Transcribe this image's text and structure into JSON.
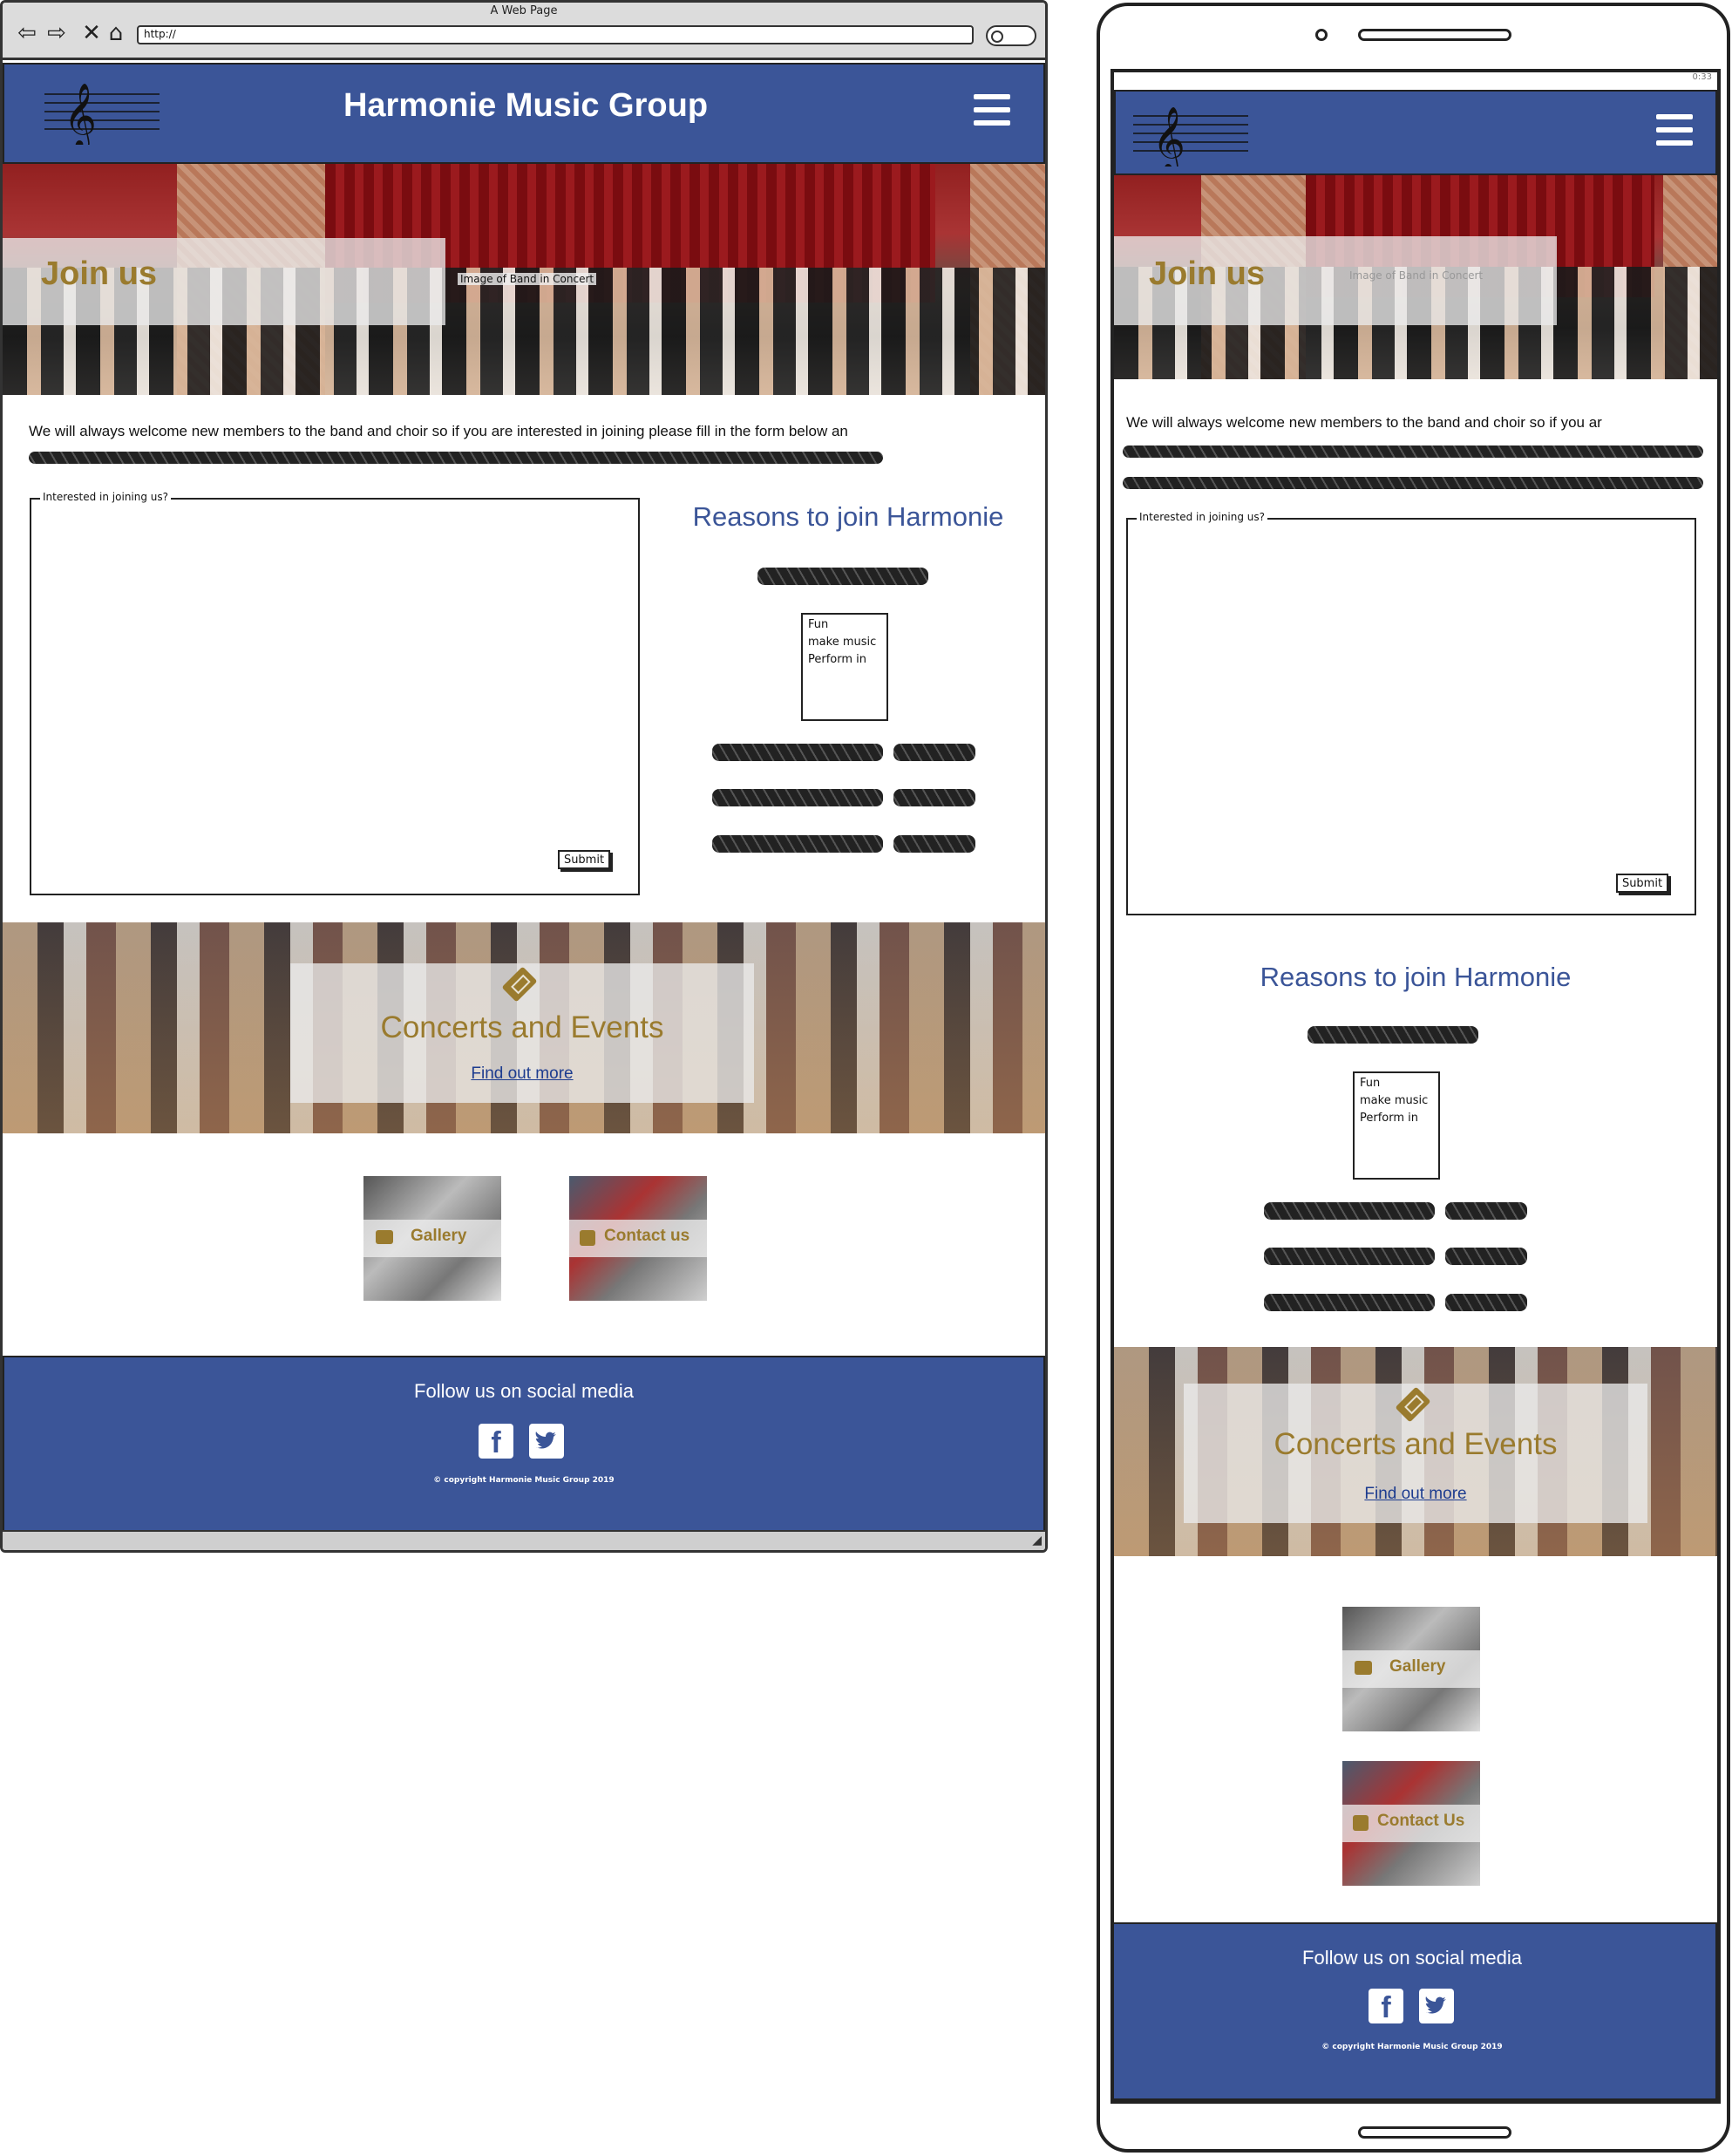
{
  "browser": {
    "window_title": "A Web Page",
    "url": "http://",
    "nav_icons": [
      "back-arrow-icon",
      "forward-arrow-icon",
      "stop-icon",
      "home-icon"
    ]
  },
  "site": {
    "title": "Harmonie Music Group",
    "logo_lines": [
      "Harmonie",
      "Music",
      "Group"
    ],
    "brand_color": "#3b5598",
    "accent_color": "#9a7b2e"
  },
  "hero": {
    "heading": "Join us",
    "image_caption": "Image of Band in Concert"
  },
  "intro": {
    "text": "We will always welcome new members to the band and choir so if you are interested in joining please fill in the form below an",
    "mobile_text": "We will always welcome new members to the band and choir so if you ar"
  },
  "form": {
    "legend": "Interested in joining us?",
    "submit_label": "Submit"
  },
  "reasons": {
    "title": "Reasons to join Harmonie",
    "list_items": [
      "Fun",
      "make music",
      "Perform in"
    ]
  },
  "concerts": {
    "title": "Concerts and Events",
    "link_label": "Find out more"
  },
  "tiles": {
    "gallery_label": "Gallery",
    "contact_label_desktop": "Contact us",
    "contact_label_mobile": "Contact Us"
  },
  "footer": {
    "heading": "Follow us on social media",
    "facebook_glyph": "f",
    "copyright": "© copyright Harmonie Music Group 2019"
  },
  "phone": {
    "status_time": "0:33"
  }
}
